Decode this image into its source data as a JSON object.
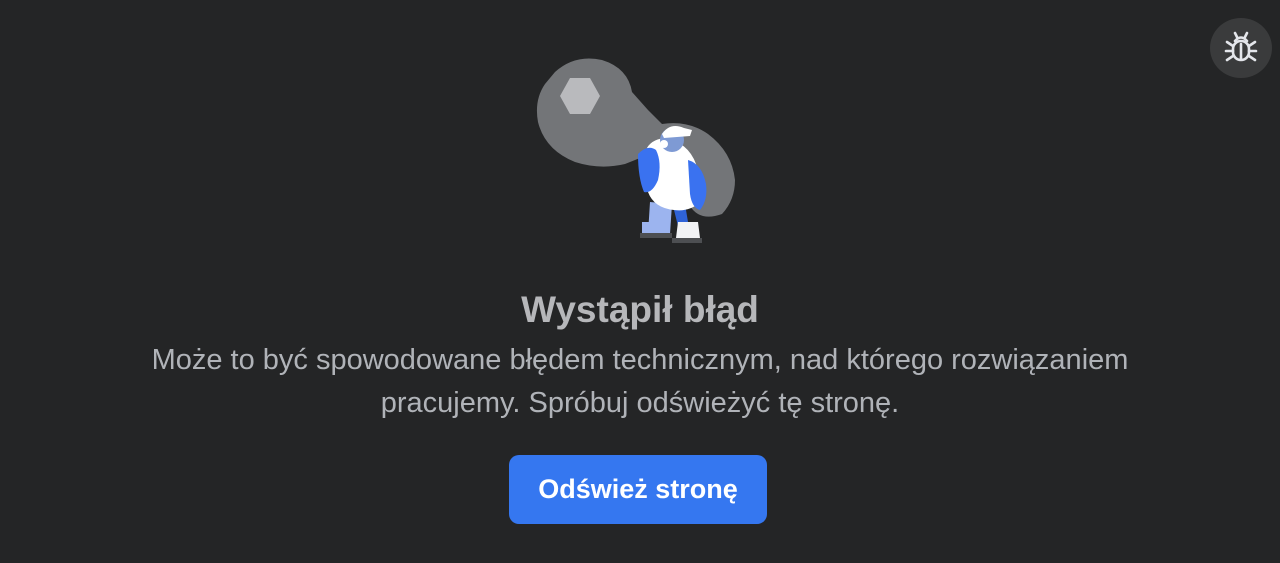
{
  "error": {
    "title": "Wystąpił błąd",
    "description_line1": "Może to być spowodowane błędem technicznym, nad którego rozwiązaniem",
    "description_line2": "pracujemy. Spróbuj odświeżyć tę stronę.",
    "refresh_button_label": "Odśwież stronę"
  },
  "toolbar": {
    "report_bug_icon": "bug-icon"
  },
  "illustration": {
    "icon": "wrench-worker-illustration"
  },
  "colors": {
    "background": "#242526",
    "accent": "#3577f0",
    "text_primary": "#b6b7ba",
    "text_secondary": "#b0b3b8"
  }
}
